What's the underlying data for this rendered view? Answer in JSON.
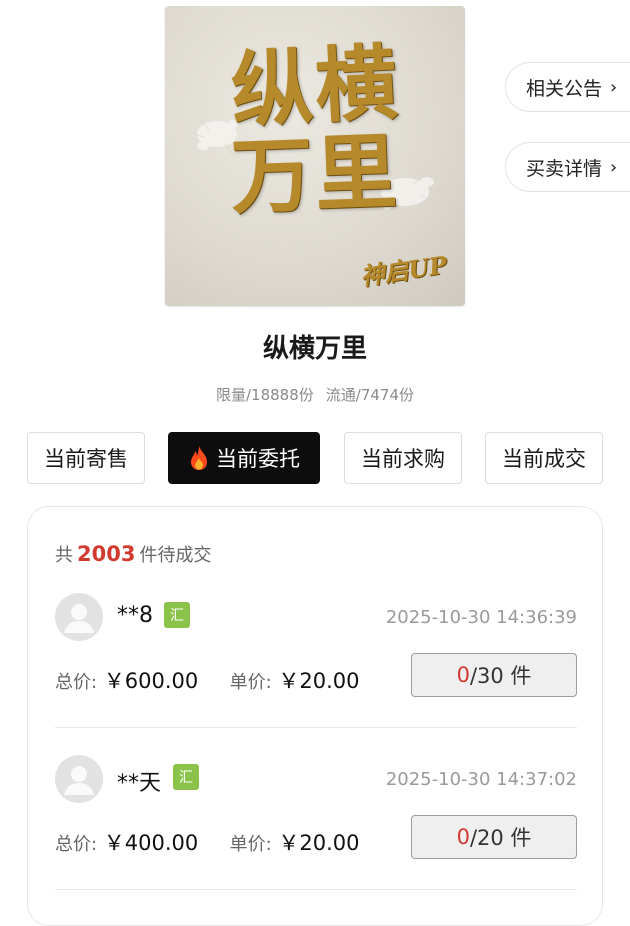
{
  "cover": {
    "title_row1": "纵横",
    "title_row2": "万里",
    "signature": "神启UP",
    "text_color": "#b68a2a"
  },
  "side_links": {
    "notice": "相关公告",
    "trade_details": "买卖详情",
    "chevron": "›"
  },
  "product": {
    "title": "纵横万里",
    "limit": "限量/18888份",
    "circulation": "流通/7474份"
  },
  "tabs": [
    {
      "label": "当前寄售",
      "active": false
    },
    {
      "label": "当前委托",
      "active": true,
      "icon": "flame-icon"
    },
    {
      "label": "当前求购",
      "active": false
    },
    {
      "label": "当前成交",
      "active": false
    }
  ],
  "summary": {
    "prefix": "共",
    "count": "2003",
    "suffix": "件待成交"
  },
  "orders": [
    {
      "user": "**8",
      "badge": "汇",
      "time": "2025-10-30 14:36:39",
      "total_label": "总价:",
      "total": "￥600.00",
      "unit_label": "单价:",
      "unit": "￥20.00",
      "sold": "0",
      "qty": "/30 件"
    },
    {
      "user": "**天",
      "badge": "汇",
      "time": "2025-10-30 14:37:02",
      "total_label": "总价:",
      "total": "￥400.00",
      "unit_label": "单价:",
      "unit": "￥20.00",
      "sold": "0",
      "qty": "/20 件"
    }
  ],
  "colors": {
    "accent_red": "#d13a2f",
    "badge_green": "#8bc34a",
    "active_tab": "#0d0d0d"
  }
}
